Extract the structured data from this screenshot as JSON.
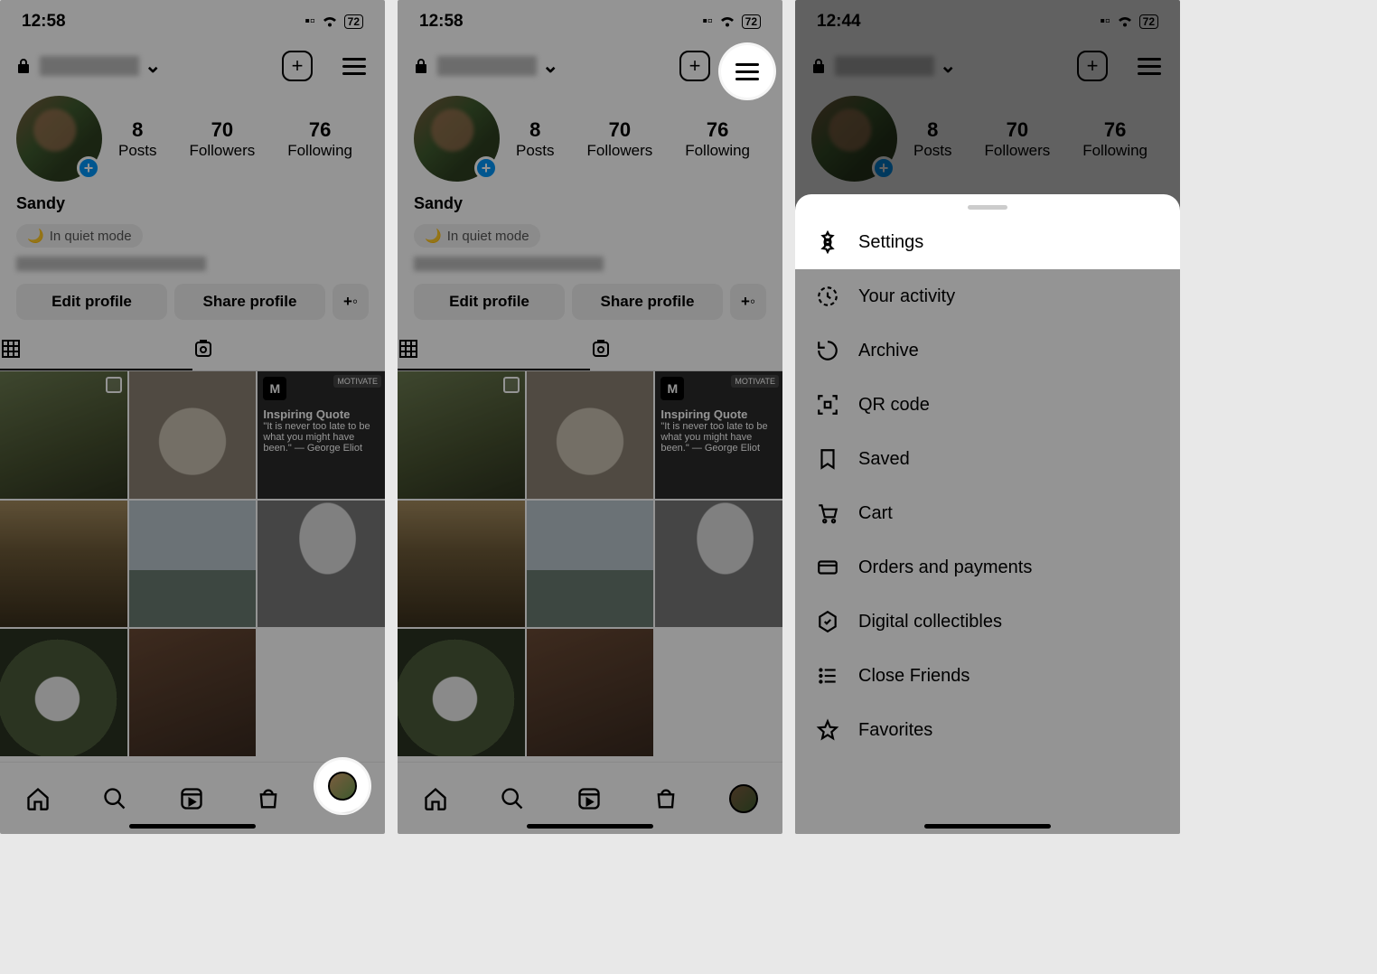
{
  "statusbar": {
    "time1": "12:58",
    "time2": "12:58",
    "time3": "12:44",
    "battery": "72"
  },
  "profile": {
    "display_name": "Sandy",
    "quiet_label": "In quiet mode",
    "edit_label": "Edit profile",
    "share_label": "Share profile",
    "posts_num": "8",
    "posts_lbl": "Posts",
    "followers_num": "70",
    "followers_lbl": "Followers",
    "following_num": "76",
    "following_lbl": "Following"
  },
  "quote": {
    "title": "Inspiring Quote",
    "body": "\"It is never too late to be what you might have been.\" — George Eliot",
    "badge": "MOTIVATE"
  },
  "menu": {
    "settings": "Settings",
    "activity": "Your activity",
    "archive": "Archive",
    "qrcode": "QR code",
    "saved": "Saved",
    "cart": "Cart",
    "orders": "Orders and payments",
    "digital": "Digital collectibles",
    "close_friends": "Close Friends",
    "favorites": "Favorites"
  }
}
